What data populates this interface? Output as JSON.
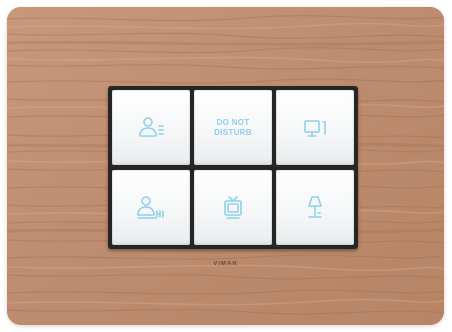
{
  "plate": {
    "finish": "light oak wood",
    "brand": "VIMAR"
  },
  "buttons": [
    {
      "id": "presence",
      "icon": "person-presence-icon",
      "label": ""
    },
    {
      "id": "do-not-disturb",
      "icon": "",
      "label": "DO NOT\nDISTURB"
    },
    {
      "id": "courtesy-light",
      "icon": "courtesy-light-icon",
      "label": ""
    },
    {
      "id": "call-reception",
      "icon": "person-call-icon",
      "label": ""
    },
    {
      "id": "television",
      "icon": "tv-icon",
      "label": ""
    },
    {
      "id": "table-lamp",
      "icon": "lamp-icon",
      "label": ""
    }
  ],
  "colors": {
    "icon": "#8fd0ea",
    "wood": "#bf8e72",
    "frame": "#262626",
    "button": "#f5f7f8"
  }
}
